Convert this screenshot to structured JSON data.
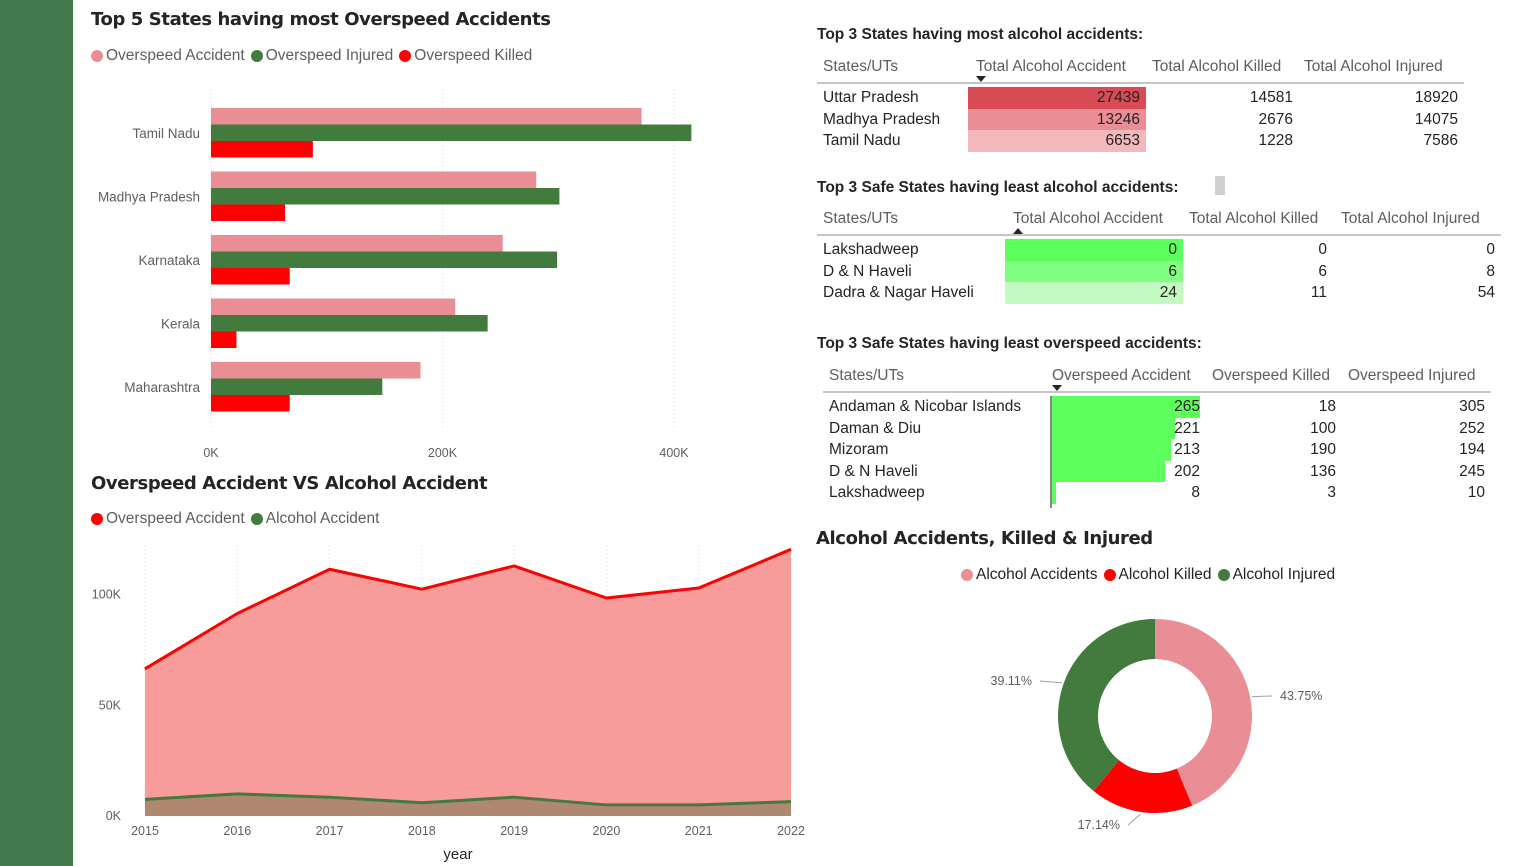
{
  "colors": {
    "sidebar": "#437a4e",
    "pink": "#e88e94",
    "green": "#437a3e",
    "red": "#ff0000",
    "area_pink": "#f89b9b",
    "area_brown": "#b0876f",
    "alcohol_high": "#d94b55",
    "alcohol_mid": "#e88e94",
    "alcohol_low": "#f2b8bc",
    "safe_high": "#5cff5c",
    "safe_mid": "#80ff80",
    "safe_low": "#c2fac2"
  },
  "bar_chart": {
    "title": "Top 5 States having most Overspeed Accidents",
    "legend": [
      {
        "label": "Overspeed Accident",
        "color": "#e88e94"
      },
      {
        "label": "Overspeed Injured",
        "color": "#437a3e"
      },
      {
        "label": "Overspeed Killed",
        "color": "#ff0000"
      }
    ]
  },
  "area_chart": {
    "title": "Overspeed Accident VS Alcohol Accident",
    "legend": [
      {
        "label": "Overspeed Accident",
        "color": "#ff0000"
      },
      {
        "label": "Alcohol Accident",
        "color": "#437a3e"
      }
    ]
  },
  "donut_chart": {
    "title": "Alcohol Accidents, Killed & Injured",
    "legend": [
      {
        "label": "Alcohol Accidents",
        "color": "#e88e94"
      },
      {
        "label": "Alcohol Killed",
        "color": "#ff0000"
      },
      {
        "label": "Alcohol Injured",
        "color": "#437a3e"
      }
    ]
  },
  "chart_data": [
    {
      "type": "bar",
      "orientation": "horizontal",
      "title": "Top 5 States having most Overspeed Accidents",
      "categories": [
        "Tamil Nadu",
        "Madhya Pradesh",
        "Karnataka",
        "Kerala",
        "Maharashtra"
      ],
      "series": [
        {
          "name": "Overspeed Accident",
          "color": "#e88e94",
          "values": [
            372000,
            281000,
            252000,
            211000,
            181000
          ]
        },
        {
          "name": "Overspeed Injured",
          "color": "#437a3e",
          "values": [
            415000,
            301000,
            299000,
            239000,
            148000
          ]
        },
        {
          "name": "Overspeed Killed",
          "color": "#ff0000",
          "values": [
            88000,
            64000,
            68000,
            22000,
            68000
          ]
        }
      ],
      "xlim": [
        0,
        420000
      ],
      "xticks": [
        0,
        200000,
        400000
      ],
      "xtick_labels": [
        "0K",
        "200K",
        "400K"
      ],
      "grid": true,
      "legend_position": "top-left"
    },
    {
      "type": "area",
      "title": "Overspeed Accident VS Alcohol Accident",
      "x": [
        2015,
        2016,
        2017,
        2018,
        2019,
        2020,
        2021,
        2022
      ],
      "xlabel": "year",
      "series": [
        {
          "name": "Overspeed Accident",
          "color": "#ff0000",
          "fill": "#f89b9b",
          "values": [
            66500,
            91500,
            111500,
            102500,
            113000,
            98500,
            103000,
            120500
          ]
        },
        {
          "name": "Alcohol Accident",
          "color": "#437a3e",
          "fill": "#b0876f",
          "values": [
            7500,
            10000,
            8500,
            6000,
            8500,
            5000,
            5000,
            6500
          ]
        }
      ],
      "ylim": [
        0,
        122000
      ],
      "yticks": [
        0,
        50000,
        100000
      ],
      "ytick_labels": [
        "0K",
        "50K",
        "100K"
      ],
      "grid": true,
      "legend_position": "top-left"
    },
    {
      "type": "pie",
      "donut": true,
      "title": "Alcohol Accidents, Killed & Injured",
      "categories": [
        "Alcohol Accidents",
        "Alcohol Killed",
        "Alcohol Injured"
      ],
      "values": [
        43.75,
        17.14,
        39.11
      ],
      "value_labels": [
        "43.75%",
        "17.14%",
        "39.11%"
      ],
      "colors": [
        "#e88e94",
        "#ff0000",
        "#437a3e"
      ],
      "legend_position": "top-center"
    },
    {
      "type": "table",
      "title": "Top 3 States having most alcohol accidents:",
      "columns": [
        "States/UTs",
        "Total Alcohol Accident",
        "Total Alcohol Killed",
        "Total Alcohol Injured"
      ],
      "rows": [
        [
          "Uttar Pradesh",
          "27439",
          "14581",
          "18920"
        ],
        [
          "Madhya Pradesh",
          "13246",
          "2676",
          "14075"
        ],
        [
          "Tamil Nadu",
          "6653",
          "1228",
          "7586"
        ]
      ]
    },
    {
      "type": "table",
      "title": "Top 3 Safe States having least alcohol accidents:",
      "columns": [
        "States/UTs",
        "Total Alcohol Accident",
        "Total Alcohol Killed",
        "Total Alcohol Injured"
      ],
      "rows": [
        [
          "Lakshadweep",
          "0",
          "0",
          "0"
        ],
        [
          "D & N Haveli",
          "6",
          "6",
          "8"
        ],
        [
          "Dadra & Nagar Haveli",
          "24",
          "11",
          "54"
        ]
      ]
    },
    {
      "type": "table",
      "title": "Top 3 Safe States having least overspeed accidents:",
      "columns": [
        "States/UTs",
        "Overspeed Accident",
        "Overspeed Killed",
        "Overspeed Injured"
      ],
      "rows": [
        [
          "Andaman & Nicobar Islands",
          "265",
          "18",
          "305"
        ],
        [
          "Daman & Diu",
          "221",
          "100",
          "252"
        ],
        [
          "Mizoram",
          "213",
          "190",
          "194"
        ],
        [
          "D & N Haveli",
          "202",
          "136",
          "245"
        ],
        [
          "Lakshadweep",
          "8",
          "3",
          "10"
        ]
      ],
      "databar_max": 265
    }
  ],
  "tables": {
    "t1": {
      "title": "Top 3 States having most alcohol accidents:",
      "col0": "States/UTs",
      "col1": "Total Alcohol Accident",
      "col2": "Total Alcohol Killed",
      "col3": "Total Alcohol Injured",
      "rows": [
        {
          "state": "Uttar Pradesh",
          "a": "27439",
          "k": "14581",
          "i": "18920"
        },
        {
          "state": "Madhya Pradesh",
          "a": "13246",
          "k": "2676",
          "i": "14075"
        },
        {
          "state": "Tamil Nadu",
          "a": "6653",
          "k": "1228",
          "i": "7586"
        }
      ]
    },
    "t2": {
      "title": "Top 3 Safe States having least alcohol accidents:",
      "col0": "States/UTs",
      "col1": "Total Alcohol Accident",
      "col2": "Total Alcohol Killed",
      "col3": "Total Alcohol Injured",
      "rows": [
        {
          "state": "Lakshadweep",
          "a": "0",
          "k": "0",
          "i": "0"
        },
        {
          "state": "D & N Haveli",
          "a": "6",
          "k": "6",
          "i": "8"
        },
        {
          "state": "Dadra & Nagar Haveli",
          "a": "24",
          "k": "11",
          "i": "54"
        }
      ]
    },
    "t3": {
      "title": "Top 3 Safe States having least overspeed accidents:",
      "col0": "States/UTs",
      "col1": "Overspeed Accident",
      "col2": "Overspeed Killed",
      "col3": "Overspeed Injured",
      "rows": [
        {
          "state": "Andaman & Nicobar Islands",
          "a": "265",
          "k": "18",
          "i": "305"
        },
        {
          "state": "Daman & Diu",
          "a": "221",
          "k": "100",
          "i": "252"
        },
        {
          "state": "Mizoram",
          "a": "213",
          "k": "190",
          "i": "194"
        },
        {
          "state": "D & N Haveli",
          "a": "202",
          "k": "136",
          "i": "245"
        },
        {
          "state": "Lakshadweep",
          "a": "8",
          "k": "3",
          "i": "10"
        }
      ]
    }
  }
}
